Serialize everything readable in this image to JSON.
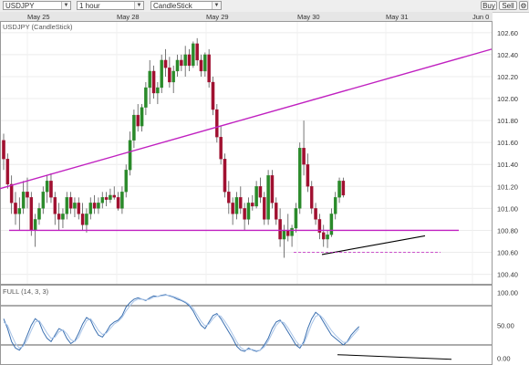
{
  "toolbar": {
    "symbol": "USDJPY",
    "timeframe": "1 hour",
    "chart_style": "CandleStick",
    "buy_label": "Buy",
    "sell_label": "Sell",
    "settings_icon": "settings-icon"
  },
  "colors": {
    "trendline": "#c020c0",
    "support": "#000000",
    "up_candle": "#2a8a2a",
    "down_candle": "#a01030",
    "stoch_k": "#3a6fb0",
    "stoch_d": "#a8c4e8"
  },
  "chart_data": [
    {
      "type": "candlestick",
      "title": "USDJPY (CandleStick)",
      "x_dates": [
        "May 25",
        "May 28",
        "May 29",
        "May 30",
        "May 31",
        "Jun 0"
      ],
      "y_ticks": [
        "102.60",
        "102.40",
        "102.20",
        "102.00",
        "101.80",
        "101.60",
        "101.40",
        "101.20",
        "101.00",
        "100.80",
        "100.60",
        "100.40"
      ],
      "ylim": [
        100.33,
        102.69
      ],
      "candles": [
        [
          101.62,
          101.68,
          101.35,
          101.45
        ],
        [
          101.45,
          101.5,
          101.18,
          101.22
        ],
        [
          101.22,
          101.3,
          100.95,
          101.05
        ],
        [
          101.05,
          101.15,
          100.85,
          100.95
        ],
        [
          100.95,
          101.1,
          100.8,
          101.0
        ],
        [
          101.0,
          101.25,
          100.95,
          101.15
        ],
        [
          101.15,
          101.28,
          101.0,
          101.1
        ],
        [
          101.1,
          101.15,
          100.75,
          100.8
        ],
        [
          100.8,
          100.95,
          100.65,
          100.9
        ],
        [
          100.9,
          101.05,
          100.85,
          101.0
        ],
        [
          101.0,
          101.2,
          100.95,
          101.15
        ],
        [
          101.15,
          101.3,
          101.05,
          101.25
        ],
        [
          101.25,
          101.32,
          101.05,
          101.1
        ],
        [
          101.1,
          101.15,
          100.85,
          100.95
        ],
        [
          100.95,
          101.05,
          100.8,
          100.9
        ],
        [
          100.9,
          101.0,
          100.82,
          100.95
        ],
        [
          100.95,
          101.15,
          100.9,
          101.1
        ],
        [
          101.1,
          101.15,
          100.95,
          101.0
        ],
        [
          101.0,
          101.1,
          100.92,
          101.05
        ],
        [
          101.05,
          101.1,
          100.9,
          100.95
        ],
        [
          100.95,
          101.05,
          100.8,
          100.85
        ],
        [
          100.85,
          101.0,
          100.78,
          100.95
        ],
        [
          100.95,
          101.1,
          100.9,
          101.05
        ],
        [
          101.05,
          101.12,
          100.95,
          101.0
        ],
        [
          101.0,
          101.1,
          100.95,
          101.05
        ],
        [
          101.05,
          101.15,
          101.0,
          101.1
        ],
        [
          101.1,
          101.15,
          101.02,
          101.08
        ],
        [
          101.08,
          101.18,
          101.05,
          101.12
        ],
        [
          101.12,
          101.2,
          101.08,
          101.1
        ],
        [
          101.1,
          101.15,
          100.98,
          101.0
        ],
        [
          101.0,
          101.2,
          100.95,
          101.15
        ],
        [
          101.15,
          101.4,
          101.1,
          101.35
        ],
        [
          101.35,
          101.7,
          101.3,
          101.62
        ],
        [
          101.62,
          101.9,
          101.55,
          101.85
        ],
        [
          101.85,
          101.95,
          101.7,
          101.75
        ],
        [
          101.75,
          101.95,
          101.7,
          101.92
        ],
        [
          101.92,
          102.15,
          101.85,
          102.1
        ],
        [
          102.1,
          102.35,
          101.95,
          102.25
        ],
        [
          102.25,
          102.3,
          102.0,
          102.05
        ],
        [
          102.05,
          102.15,
          101.95,
          102.1
        ],
        [
          102.1,
          102.4,
          102.05,
          102.35
        ],
        [
          102.35,
          102.45,
          102.2,
          102.28
        ],
        [
          102.28,
          102.38,
          102.1,
          102.15
        ],
        [
          102.15,
          102.3,
          102.05,
          102.25
        ],
        [
          102.25,
          102.4,
          102.2,
          102.35
        ],
        [
          102.35,
          102.4,
          102.25,
          102.3
        ],
        [
          102.3,
          102.48,
          102.2,
          102.4
        ],
        [
          102.4,
          102.45,
          102.25,
          102.3
        ],
        [
          102.3,
          102.52,
          102.28,
          102.5
        ],
        [
          102.5,
          102.55,
          102.3,
          102.35
        ],
        [
          102.35,
          102.4,
          102.2,
          102.25
        ],
        [
          102.25,
          102.42,
          102.2,
          102.4
        ],
        [
          102.4,
          102.45,
          102.1,
          102.15
        ],
        [
          102.15,
          102.2,
          101.85,
          101.9
        ],
        [
          101.9,
          101.95,
          101.6,
          101.65
        ],
        [
          101.65,
          101.75,
          101.4,
          101.45
        ],
        [
          101.45,
          101.5,
          101.1,
          101.15
        ],
        [
          101.15,
          101.25,
          100.95,
          101.05
        ],
        [
          101.05,
          101.1,
          100.85,
          100.95
        ],
        [
          100.95,
          101.15,
          100.9,
          101.1
        ],
        [
          101.1,
          101.2,
          100.95,
          101.0
        ],
        [
          101.0,
          101.05,
          100.8,
          100.9
        ],
        [
          100.9,
          101.1,
          100.85,
          101.05
        ],
        [
          101.05,
          101.12,
          100.98,
          101.02
        ],
        [
          101.02,
          101.25,
          101.0,
          101.2
        ],
        [
          101.2,
          101.28,
          101.05,
          101.1
        ],
        [
          101.1,
          101.15,
          100.85,
          100.9
        ],
        [
          100.9,
          101.35,
          100.85,
          101.3
        ],
        [
          101.3,
          101.35,
          101.0,
          101.05
        ],
        [
          101.05,
          101.1,
          100.85,
          100.9
        ],
        [
          100.9,
          101.0,
          100.65,
          100.72
        ],
        [
          100.72,
          100.85,
          100.55,
          100.8
        ],
        [
          100.8,
          100.95,
          100.7,
          100.75
        ],
        [
          100.75,
          100.85,
          100.65,
          100.82
        ],
        [
          100.82,
          101.05,
          100.78,
          101.0
        ],
        [
          101.0,
          101.6,
          100.95,
          101.55
        ],
        [
          101.55,
          101.8,
          101.3,
          101.4
        ],
        [
          101.4,
          101.5,
          101.15,
          101.2
        ],
        [
          101.2,
          101.25,
          100.95,
          101.0
        ],
        [
          101.0,
          101.05,
          100.85,
          100.9
        ],
        [
          100.9,
          100.95,
          100.72,
          100.78
        ],
        [
          100.78,
          100.85,
          100.65,
          100.72
        ],
        [
          100.72,
          100.8,
          100.64,
          100.76
        ],
        [
          100.76,
          101.0,
          100.74,
          100.95
        ],
        [
          100.95,
          101.15,
          100.9,
          101.1
        ],
        [
          101.1,
          101.28,
          101.05,
          101.25
        ],
        [
          101.25,
          101.28,
          101.1,
          101.12
        ]
      ],
      "trendlines": [
        {
          "name": "rising-trendline",
          "points": [
            [
              0,
              101.18
            ],
            [
              116,
              102.45
            ]
          ]
        },
        {
          "name": "horizontal-support",
          "points": [
            [
              0,
              100.8
            ],
            [
              116,
              100.8
            ]
          ]
        },
        {
          "name": "rising-support",
          "points": [
            [
              79,
              100.58
            ],
            [
              93,
              100.75
            ]
          ]
        },
        {
          "name": "dashed-low",
          "points": [
            [
              72,
              100.6
            ],
            [
              99,
              100.6
            ]
          ]
        }
      ]
    },
    {
      "type": "line",
      "title": "FULL (14, 3, 3)",
      "y_ticks": [
        "100.00",
        "50.00",
        "0.00"
      ],
      "ylim": [
        -8,
        108
      ],
      "levels": [
        80,
        20
      ],
      "series": [
        {
          "values": [
            60,
            45,
            25,
            15,
            12,
            20,
            35,
            50,
            60,
            55,
            40,
            30,
            25,
            35,
            45,
            42,
            30,
            22,
            26,
            38,
            52,
            62,
            58,
            45,
            35,
            32,
            40,
            50,
            55,
            58,
            65,
            78,
            85,
            90,
            92,
            90,
            88,
            92,
            95,
            94,
            96,
            97,
            95,
            93,
            90,
            88,
            85,
            80,
            72,
            60,
            50,
            45,
            55,
            65,
            68,
            60,
            50,
            40,
            30,
            18,
            12,
            10,
            15,
            12,
            10,
            12,
            20,
            30,
            45,
            55,
            58,
            50,
            40,
            30,
            20,
            15,
            25,
            45,
            60,
            70,
            65,
            55,
            45,
            35,
            30,
            25,
            20,
            25,
            35,
            42,
            48
          ]
        },
        {
          "values": [
            55,
            50,
            35,
            22,
            15,
            18,
            28,
            42,
            55,
            57,
            48,
            38,
            30,
            32,
            40,
            43,
            37,
            28,
            25,
            32,
            45,
            57,
            60,
            52,
            42,
            36,
            38,
            45,
            52,
            56,
            62,
            72,
            80,
            87,
            90,
            90,
            89,
            90,
            93,
            94,
            95,
            96,
            96,
            94,
            92,
            89,
            86,
            82,
            76,
            66,
            56,
            49,
            52,
            60,
            66,
            64,
            56,
            47,
            36,
            25,
            16,
            12,
            13,
            13,
            11,
            12,
            17,
            26,
            38,
            50,
            56,
            54,
            46,
            36,
            26,
            19,
            22,
            36,
            52,
            64,
            66,
            60,
            51,
            42,
            35,
            29,
            24,
            24,
            31,
            38,
            45
          ]
        }
      ],
      "trendlines": [
        {
          "name": "stoch-support",
          "points": [
            [
              72,
              5
            ],
            [
              99,
              -2
            ]
          ]
        }
      ]
    }
  ]
}
